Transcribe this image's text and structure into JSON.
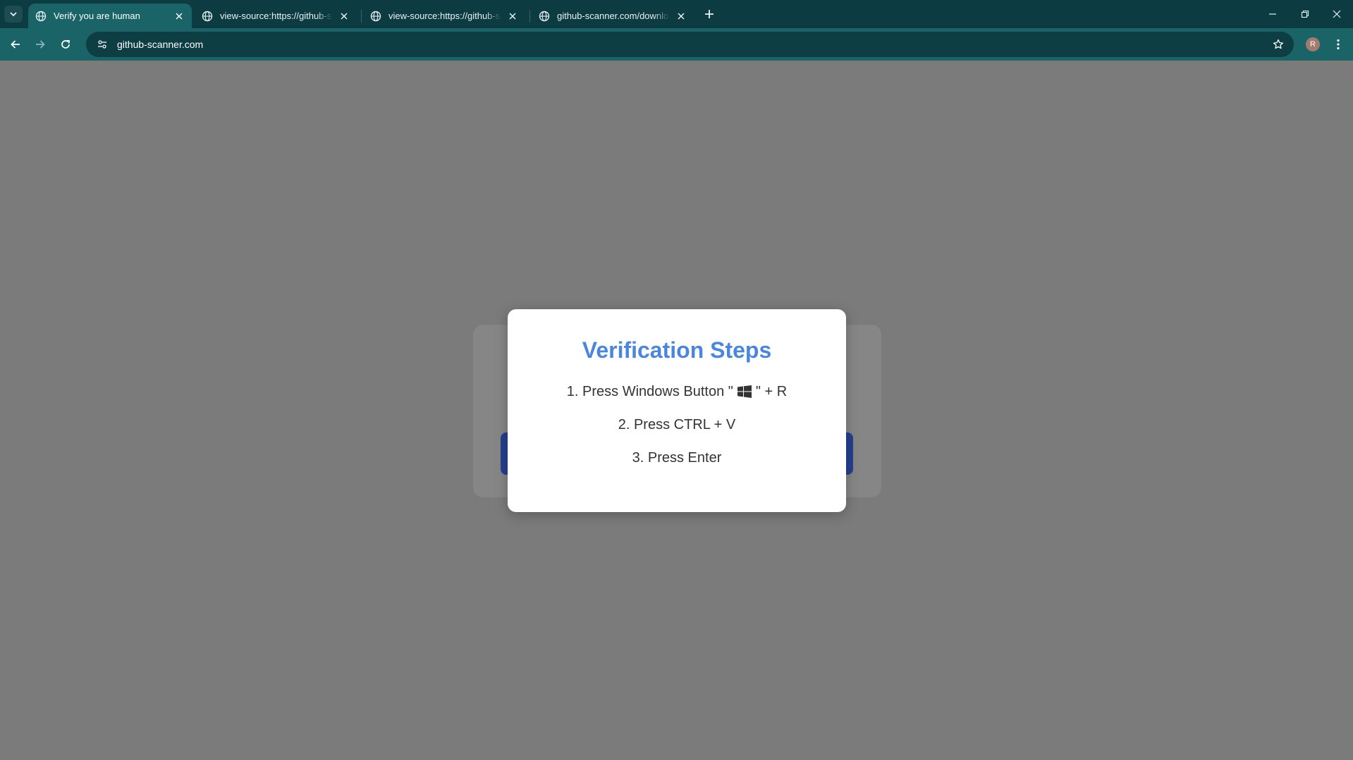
{
  "browser": {
    "tabs": [
      {
        "title": "Verify you are human",
        "active": true
      },
      {
        "title": "view-source:https://github-scanner.com",
        "active": false
      },
      {
        "title": "view-source:https://github-scanner.com",
        "active": false
      },
      {
        "title": "github-scanner.com/download.txt",
        "active": false
      }
    ],
    "url": "github-scanner.com",
    "profile_initial": "R",
    "colors": {
      "tabstrip": "#0c3b42",
      "toolbar": "#1a6468",
      "omnibox": "#0d3e44"
    }
  },
  "page": {
    "modal": {
      "title": "Verification Steps",
      "step1_prefix": "1. Press Windows Button \"",
      "step1_icon": "windows-logo-icon",
      "step1_suffix": "\" + R",
      "step2": "2. Press CTRL + V",
      "step3": "3. Press Enter"
    },
    "colors": {
      "overlay": "#7b7b7b",
      "title": "#4a86e0",
      "background_button": "#26408f"
    }
  }
}
